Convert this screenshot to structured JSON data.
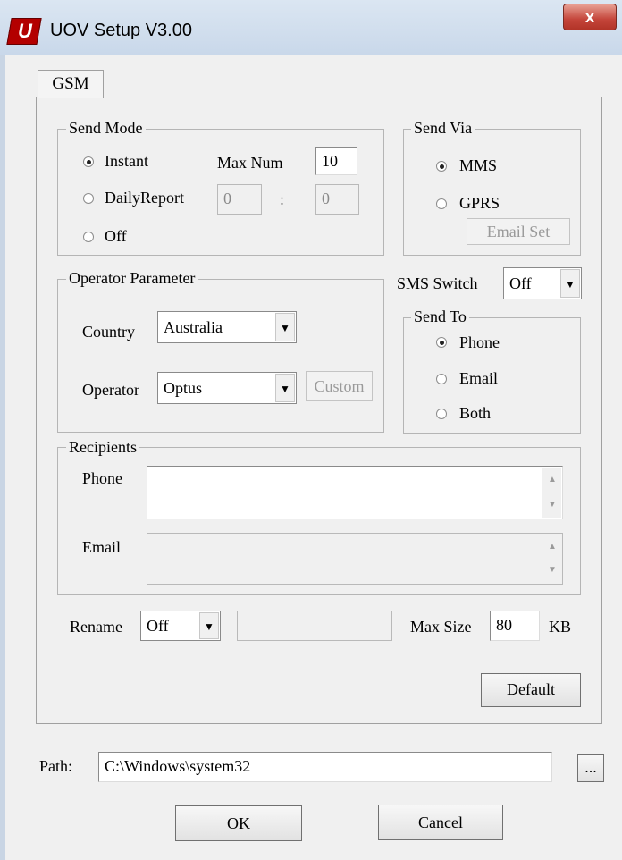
{
  "window": {
    "title": "UOV Setup V3.00",
    "close_glyph": "x",
    "icon_glyph": "U"
  },
  "tabs": [
    {
      "label": "GSM"
    }
  ],
  "send_mode": {
    "legend": "Send Mode",
    "options": [
      {
        "label": "Instant",
        "selected": true
      },
      {
        "label": "DailyReport",
        "selected": false
      },
      {
        "label": "Off",
        "selected": false
      }
    ],
    "max_num_label": "Max Num",
    "max_num_value": "10",
    "daily_from": "0",
    "daily_sep": ":",
    "daily_to": "0"
  },
  "send_via": {
    "legend": "Send Via",
    "options": [
      {
        "label": "MMS",
        "selected": true
      },
      {
        "label": "GPRS",
        "selected": false
      }
    ],
    "email_set_label": "Email Set"
  },
  "operator_parameter": {
    "legend": "Operator Parameter",
    "country_label": "Country",
    "country_value": "Australia",
    "operator_label": "Operator",
    "operator_value": "Optus",
    "custom_label": "Custom"
  },
  "sms_switch": {
    "label": "SMS Switch",
    "value": "Off"
  },
  "send_to": {
    "legend": "Send To",
    "options": [
      {
        "label": "Phone",
        "selected": true
      },
      {
        "label": "Email",
        "selected": false
      },
      {
        "label": "Both",
        "selected": false
      }
    ]
  },
  "recipients": {
    "legend": "Recipients",
    "phone_label": "Phone",
    "phone_value": "",
    "email_label": "Email",
    "email_value": ""
  },
  "rename": {
    "label": "Rename",
    "value": "Off",
    "text_value": ""
  },
  "max_size": {
    "label": "Max Size",
    "value": "80",
    "unit": "KB"
  },
  "default_button": "Default",
  "path": {
    "label": "Path:",
    "value": "C:\\Windows\\system32",
    "browse_label": "..."
  },
  "ok_button": "OK",
  "cancel_button": "Cancel",
  "colors": {
    "title_bar": "#c9d8ea",
    "close_button": "#c4453a",
    "icon_red": "#b30000",
    "dialog_bg": "#f0f0f0"
  }
}
